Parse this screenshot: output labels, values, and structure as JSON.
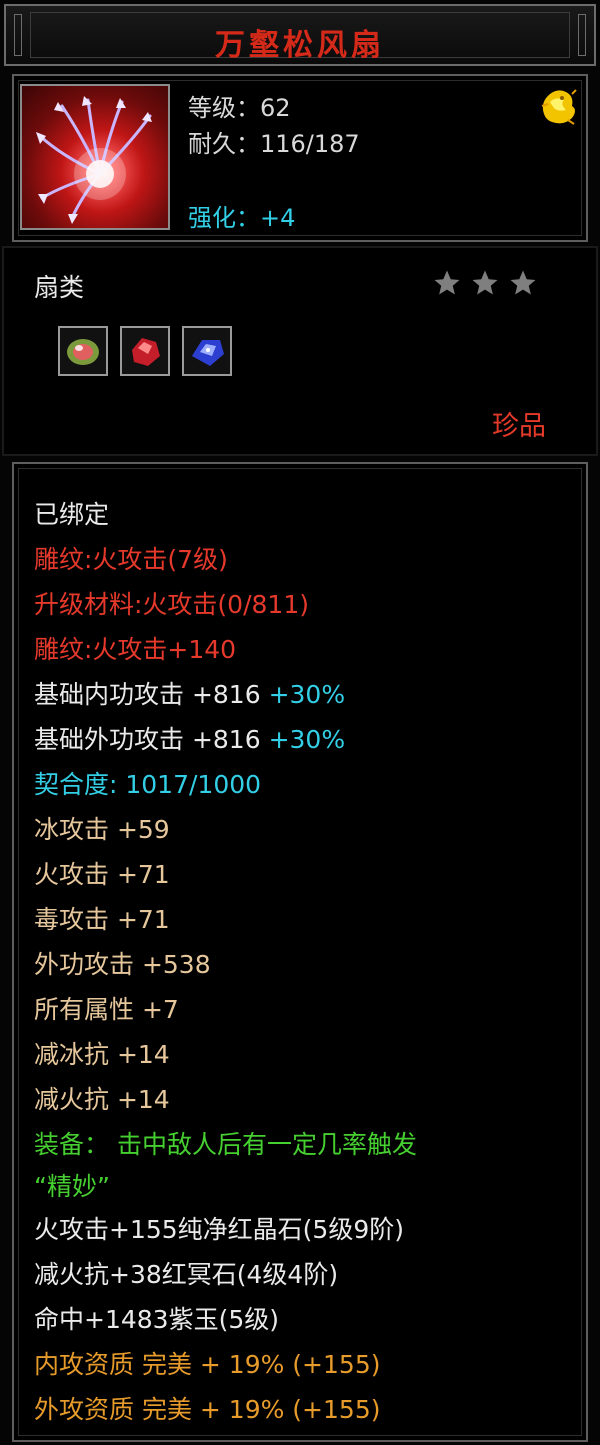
{
  "item": {
    "name": "万壑松风扇",
    "level_label": "等级：62",
    "durability_label": "耐久：116/187",
    "enhance_label": "强化：+4",
    "category": "扇类",
    "stars": 3,
    "rarity": "珍品"
  },
  "gems": [
    {
      "name": "green-red-gem-icon"
    },
    {
      "name": "red-gem-icon"
    },
    {
      "name": "blue-gem-icon"
    }
  ],
  "attributes": {
    "bound": "已绑定",
    "engrave_1": "雕纹:火攻击(7级)",
    "upgrade_material": "升级材料:火攻击(0/811)",
    "engrave_2": "雕纹:火攻击+140",
    "base_inner_label": "基础内功攻击  +816",
    "base_inner_pct": "+30%",
    "base_outer_label": "基础外功攻击  +816",
    "base_outer_pct": "+30%",
    "fit": "契合度: 1017/1000",
    "ice_attack": "冰攻击  +59",
    "fire_attack": "火攻击  +71",
    "poison_attack": "毒攻击  +71",
    "outer_attack": "外功攻击  +538",
    "all_attributes": "所有属性  +7",
    "reduce_ice_res": "减冰抗  +14",
    "reduce_fire_res": "减火抗  +14",
    "equip_effect_1": "装备：  击中敌人后有一定几率触发",
    "equip_effect_2": "“精妙”",
    "socket_1": "火攻击+155纯净红晶石(5级9阶)",
    "socket_2": "减火抗+38红冥石(4级4阶)",
    "socket_3": "命中+1483紫玉(5级)",
    "inner_quality": "内攻资质  完美  +  19%  (+155)",
    "outer_quality": "外攻资质  完美  +  19%  (+155)"
  },
  "colors": {
    "title": "#d52a19",
    "red_text": "#e5392c",
    "cyan_text": "#33cfe6",
    "tan_text": "#e6c79c",
    "green_text": "#46cf30",
    "orange_text": "#e69b2b"
  }
}
